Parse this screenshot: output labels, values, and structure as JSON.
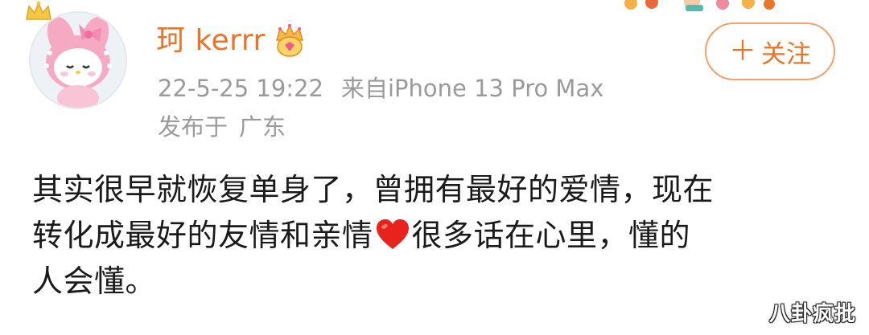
{
  "user": {
    "name": "珂 kerrr",
    "avatar_icon": "my-melody-avatar-icon",
    "badge_icon": "vip-crown-badge-icon",
    "name_color": "#e8752a"
  },
  "meta": {
    "time": "22-5-25 19:22",
    "source": "来自iPhone 13 Pro Max",
    "location_label": "发布于",
    "location": "广东"
  },
  "follow_button": {
    "label": "关注",
    "icon": "plus-icon"
  },
  "post": {
    "line1": "其实很早就恢复单身了，曾拥有最好的爱情，现在",
    "line2_before_heart": "转化成最好的友情和亲情",
    "heart_icon": "red-heart-icon",
    "line2_after_heart": "很多话在心里，懂的",
    "line3": "人会懂。"
  },
  "watermark": {
    "text": "八卦疯批"
  },
  "colors": {
    "accent": "#e8752a",
    "meta_text": "#9a9a9a",
    "body_text": "#1a1a1a",
    "heart": "#e8231f"
  }
}
